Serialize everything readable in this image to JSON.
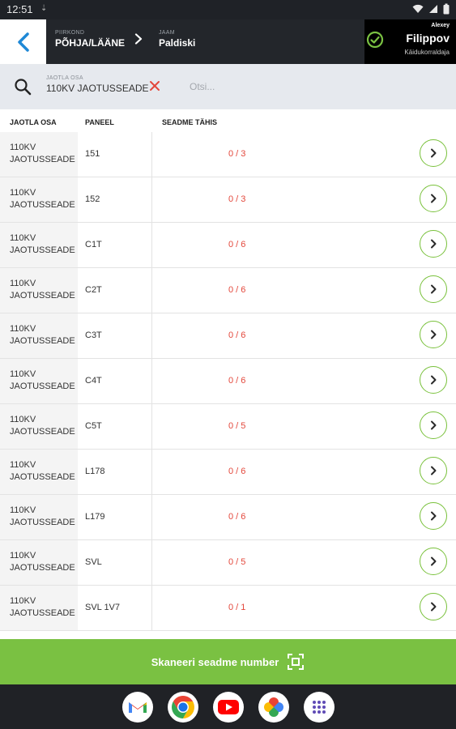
{
  "status_bar": {
    "time": "12:51",
    "notification": "⇣"
  },
  "header": {
    "crumbs": [
      {
        "label": "PIIRKOND",
        "value": "PÕHJA/LÄÄNE"
      },
      {
        "label": "JAAM",
        "value": "Paldiski"
      }
    ],
    "user": {
      "first_name": "Alexey",
      "last_name": "Filippov",
      "role": "Käidukorraldaja"
    }
  },
  "search": {
    "filter_label": "JAOTLA OSA",
    "filter_value": "110KV JAOTUSSEADE",
    "placeholder": "Otsi..."
  },
  "table": {
    "headers": [
      "JAOTLA OSA",
      "PANEEL",
      "SEADME TÄHIS"
    ],
    "rows": [
      {
        "osa_line1": "110KV",
        "osa_line2": "JAOTUSSEADE",
        "paneel": "151",
        "count": "0 / 3"
      },
      {
        "osa_line1": "110KV",
        "osa_line2": "JAOTUSSEADE",
        "paneel": "152",
        "count": "0 / 3"
      },
      {
        "osa_line1": "110KV",
        "osa_line2": "JAOTUSSEADE",
        "paneel": "C1T",
        "count": "0 / 6"
      },
      {
        "osa_line1": "110KV",
        "osa_line2": "JAOTUSSEADE",
        "paneel": "C2T",
        "count": "0 / 6"
      },
      {
        "osa_line1": "110KV",
        "osa_line2": "JAOTUSSEADE",
        "paneel": "C3T",
        "count": "0 / 6"
      },
      {
        "osa_line1": "110KV",
        "osa_line2": "JAOTUSSEADE",
        "paneel": "C4T",
        "count": "0 / 6"
      },
      {
        "osa_line1": "110KV",
        "osa_line2": "JAOTUSSEADE",
        "paneel": "C5T",
        "count": "0 / 5"
      },
      {
        "osa_line1": "110KV",
        "osa_line2": "JAOTUSSEADE",
        "paneel": "L178",
        "count": "0 / 6"
      },
      {
        "osa_line1": "110KV",
        "osa_line2": "JAOTUSSEADE",
        "paneel": "L179",
        "count": "0 / 6"
      },
      {
        "osa_line1": "110KV",
        "osa_line2": "JAOTUSSEADE",
        "paneel": "SVL",
        "count": "0 / 5"
      },
      {
        "osa_line1": "110KV",
        "osa_line2": "JAOTUSSEADE",
        "paneel": "SVL 1V7",
        "count": "0 / 1"
      }
    ]
  },
  "scan_button": {
    "label": "Skaneeri seadme number",
    "icon": "scan-frame-icon"
  },
  "dock": {
    "apps": [
      "gmail-icon",
      "chrome-icon",
      "youtube-icon",
      "photos-icon",
      "app-drawer-icon"
    ]
  },
  "colors": {
    "header_bg": "#23262b",
    "accent_green": "#7ac142",
    "count_red": "#e3473b",
    "back_blue": "#1e88d6"
  }
}
